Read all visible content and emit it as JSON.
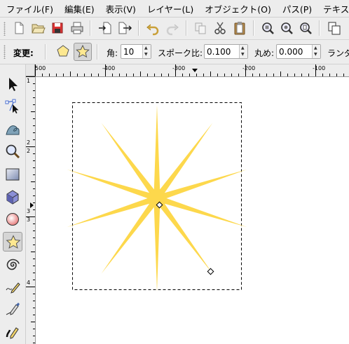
{
  "menubar": {
    "items": [
      "ファイル(F)",
      "編集(E)",
      "表示(V)",
      "レイヤー(L)",
      "オブジェクト(O)",
      "パス(P)",
      "テキス"
    ]
  },
  "commands": {
    "icons": [
      "new-document-icon",
      "open-icon",
      "save-icon",
      "print-icon",
      "import-icon",
      "export-icon",
      "undo-icon",
      "redo-icon",
      "copy-icon",
      "cut-icon",
      "paste-icon",
      "zoom-selection-icon",
      "zoom-drawing-icon",
      "zoom-page-icon",
      "duplicate-icon"
    ]
  },
  "controls": {
    "mode_label": "変更:",
    "corners_label": "角:",
    "corners_value": "10",
    "spoke_label": "スポーク比:",
    "spoke_value": "0.100",
    "rounded_label": "丸め:",
    "rounded_value": "0.000",
    "random_label": "ランダ"
  },
  "ruler": {
    "h_labels": [
      "500",
      "-400",
      "-300",
      "-200",
      "-100"
    ],
    "v_labels": [
      "1",
      "2",
      "2",
      "3",
      "3",
      "4"
    ]
  },
  "tools": [
    "selector-tool",
    "node-tool",
    "tweak-tool",
    "zoom-tool",
    "rectangle-tool",
    "3d-box-tool",
    "ellipse-tool",
    "star-tool",
    "spiral-tool",
    "pencil-tool",
    "pen-tool",
    "calligraphy-tool"
  ],
  "star": {
    "corners": 10,
    "spoke_ratio": 0.1,
    "rounded": 0.0,
    "fill_color": "#fdd84c"
  }
}
